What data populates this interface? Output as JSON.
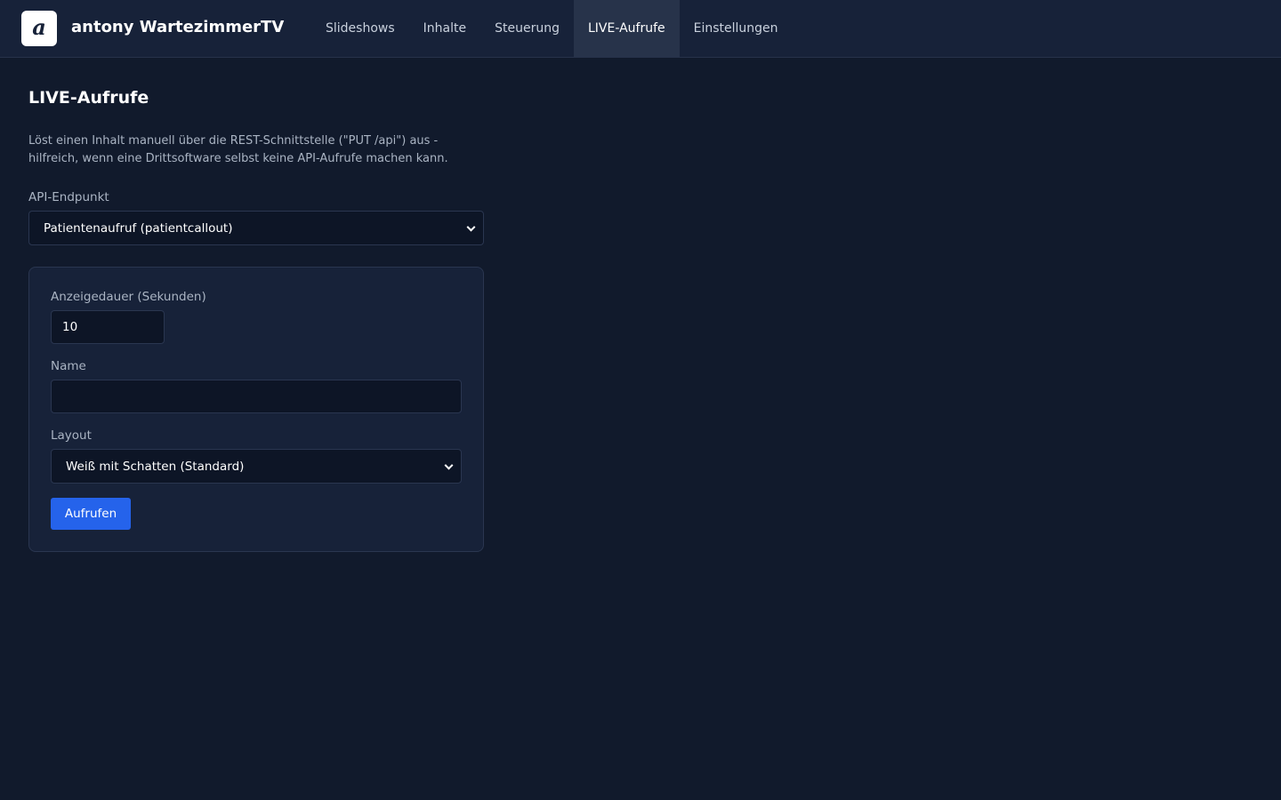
{
  "header": {
    "logo_letter": "a",
    "app_title": "antony WartezimmerTV",
    "nav": [
      {
        "label": "Slideshows",
        "active": false
      },
      {
        "label": "Inhalte",
        "active": false
      },
      {
        "label": "Steuerung",
        "active": false
      },
      {
        "label": "LIVE-Aufrufe",
        "active": true
      },
      {
        "label": "Einstellungen",
        "active": false
      }
    ]
  },
  "main": {
    "title": "LIVE-Aufrufe",
    "description": "Löst einen Inhalt manuell über die REST-Schnittstelle (\"PUT /api\") aus - hilfreich, wenn eine Drittsoftware selbst keine API-Aufrufe machen kann.",
    "endpoint": {
      "label": "API-Endpunkt",
      "selected": "Patientenaufruf (patientcallout)"
    },
    "form": {
      "duration_label": "Anzeigedauer (Sekunden)",
      "duration_value": "10",
      "name_label": "Name",
      "name_value": "",
      "layout_label": "Layout",
      "layout_selected": "Weiß mit Schatten (Standard)",
      "submit_label": "Aufrufen"
    }
  },
  "colors": {
    "background": "#111a2c",
    "header": "#172239",
    "accent": "#2563eb",
    "active_tab": "#27334a"
  }
}
